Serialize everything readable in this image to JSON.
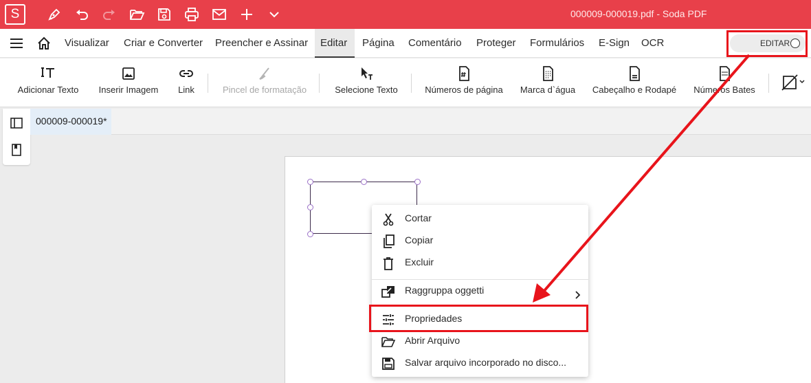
{
  "app": {
    "logo_letter": "S",
    "window_title": "000009-000019.pdf   -   Soda PDF"
  },
  "quick_access": [
    "pen-icon",
    "undo-icon",
    "redo-icon",
    "open-folder-icon",
    "save-icon",
    "print-icon",
    "mail-icon",
    "plus-icon",
    "chevron-down-icon"
  ],
  "menu": {
    "items": [
      "Visualizar",
      "Criar e Converter",
      "Preencher e Assinar",
      "Editar",
      "Página",
      "Comentário",
      "Proteger",
      "Formulários",
      "E-Sign",
      "OCR"
    ],
    "active": "Editar",
    "toggle_label": "EDITAR"
  },
  "toolbar": {
    "tools": [
      {
        "label": "Adicionar Texto",
        "icon": "add-text-icon"
      },
      {
        "label": "Inserir Imagem",
        "icon": "image-icon"
      },
      {
        "label": "Link",
        "icon": "link-icon"
      },
      {
        "label": "Pincel de formatação",
        "icon": "format-brush-icon",
        "disabled": true
      },
      {
        "label": "Selecione Texto",
        "icon": "select-text-icon"
      },
      {
        "label": "Números de página",
        "icon": "page-number-icon"
      },
      {
        "label": "Marca d`água",
        "icon": "watermark-icon"
      },
      {
        "label": "Cabeçalho e Rodapé",
        "icon": "header-footer-icon"
      },
      {
        "label": "Números Bates",
        "icon": "bates-number-icon"
      }
    ]
  },
  "document": {
    "tab_label": "000009-000019*"
  },
  "context_menu": {
    "items": [
      {
        "label": "Cortar",
        "icon": "scissors-icon"
      },
      {
        "label": "Copiar",
        "icon": "copy-icon"
      },
      {
        "label": "Excluir",
        "icon": "trash-icon"
      },
      {
        "label": "Raggruppa oggetti",
        "icon": "group-icon",
        "submenu": true
      },
      {
        "label": "Propriedades",
        "icon": "properties-icon"
      },
      {
        "label": "Abrir Arquivo",
        "icon": "open-file-icon"
      },
      {
        "label": "Salvar arquivo incorporado no disco...",
        "icon": "save-file-icon"
      }
    ]
  },
  "colors": {
    "brand_red": "#e8404a",
    "highlight_red": "#e8141b",
    "selection_purple": "#9a6fc7"
  }
}
